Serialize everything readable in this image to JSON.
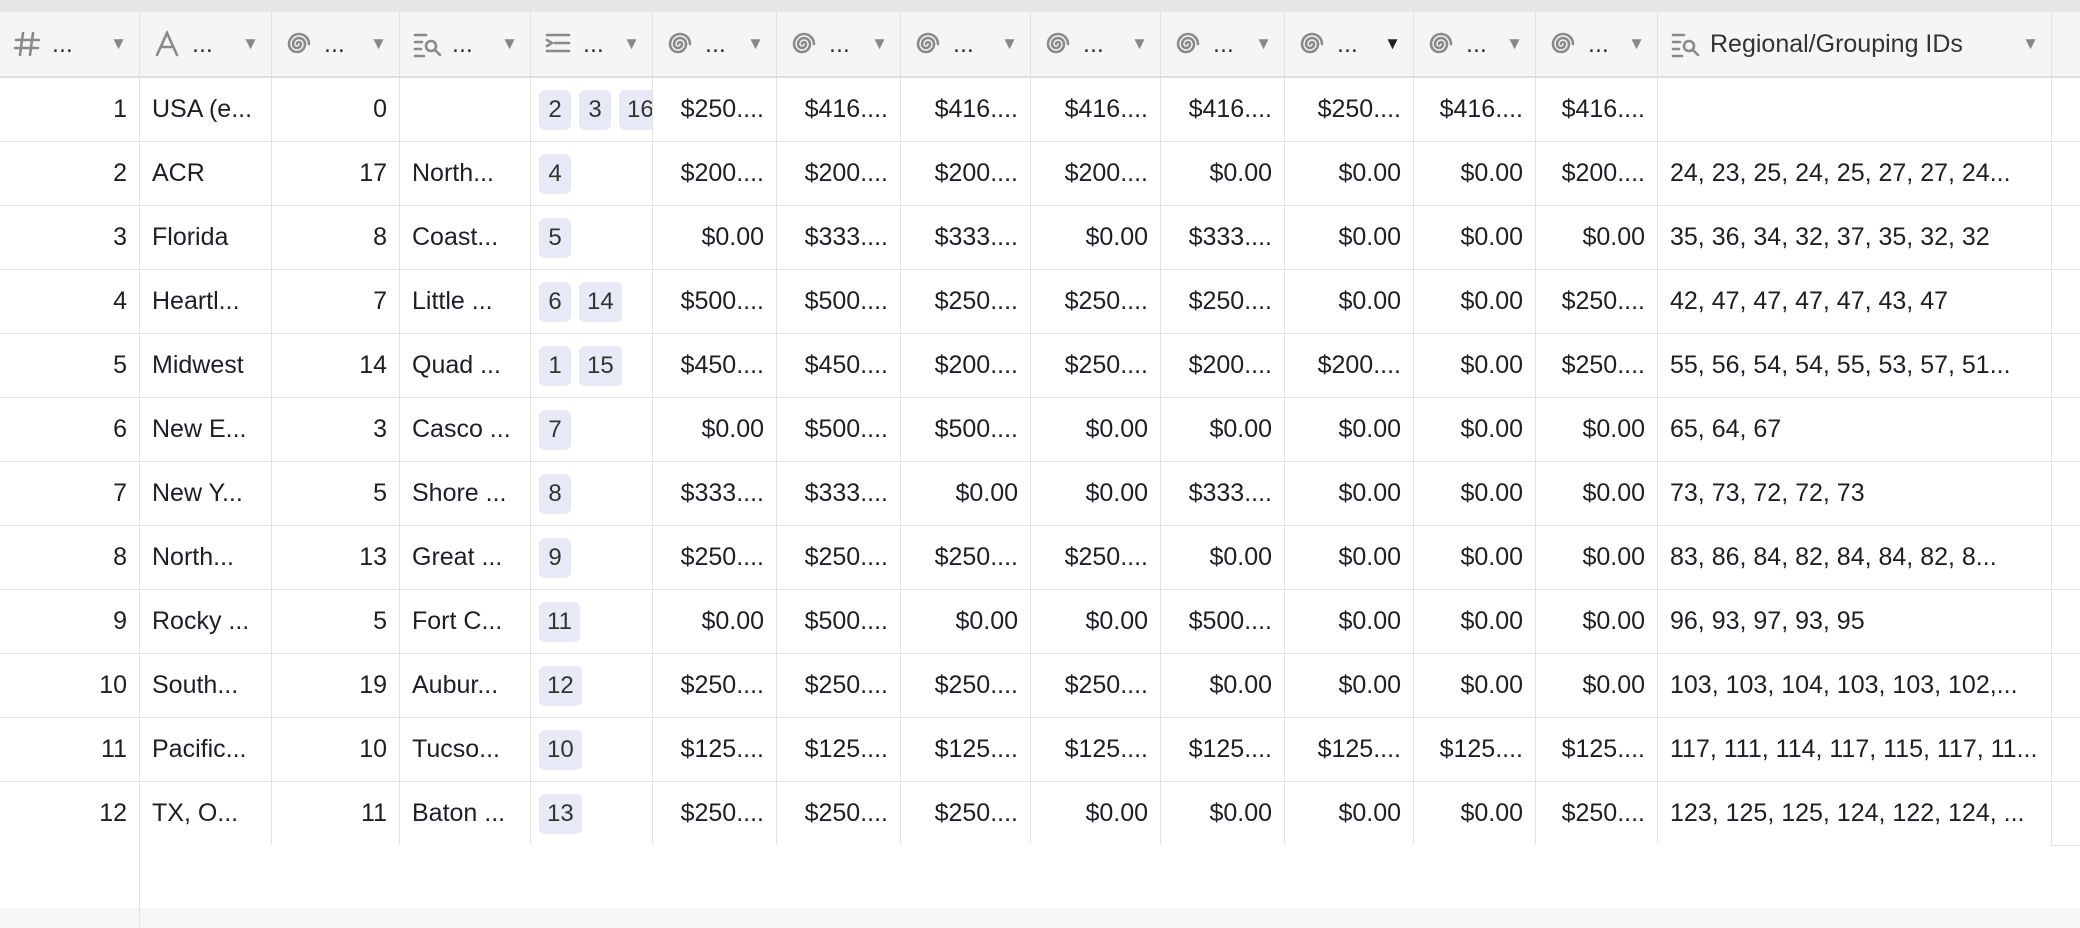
{
  "columns": [
    {
      "label": "...",
      "icon": "hash-icon"
    },
    {
      "label": "...",
      "icon": "text-icon"
    },
    {
      "label": "...",
      "icon": "spiral-icon"
    },
    {
      "label": "...",
      "icon": "lookup-icon"
    },
    {
      "label": "...",
      "icon": "linked-records-icon"
    },
    {
      "label": "...",
      "icon": "spiral-icon"
    },
    {
      "label": "...",
      "icon": "spiral-icon"
    },
    {
      "label": "...",
      "icon": "spiral-icon"
    },
    {
      "label": "...",
      "icon": "spiral-icon"
    },
    {
      "label": "...",
      "icon": "spiral-icon"
    },
    {
      "label": "...",
      "icon": "spiral-icon",
      "sorted": true
    },
    {
      "label": "...",
      "icon": "spiral-icon"
    },
    {
      "label": "...",
      "icon": "spiral-icon"
    },
    {
      "label": "Regional/Grouping IDs",
      "icon": "lookup-icon"
    }
  ],
  "rows": [
    {
      "id": "1",
      "name": "USA (e...",
      "count": "0",
      "lookup": "",
      "links": [
        "2",
        "3",
        "16"
      ],
      "m": [
        "$250....",
        "$416....",
        "$416....",
        "$416....",
        "$416....",
        "$250....",
        "$416....",
        "$416...."
      ],
      "ids": ""
    },
    {
      "id": "2",
      "name": "ACR",
      "count": "17",
      "lookup": "North...",
      "links": [
        "4"
      ],
      "m": [
        "$200....",
        "$200....",
        "$200....",
        "$200....",
        "$0.00",
        "$0.00",
        "$0.00",
        "$200...."
      ],
      "ids": "24, 23, 25, 24, 25, 27, 27, 24..."
    },
    {
      "id": "3",
      "name": "Florida",
      "count": "8",
      "lookup": "Coast...",
      "links": [
        "5"
      ],
      "m": [
        "$0.00",
        "$333....",
        "$333....",
        "$0.00",
        "$333....",
        "$0.00",
        "$0.00",
        "$0.00"
      ],
      "ids": "35, 36, 34, 32, 37, 35, 32, 32"
    },
    {
      "id": "4",
      "name": "Heartl...",
      "count": "7",
      "lookup": "Little ...",
      "links": [
        "6",
        "14"
      ],
      "m": [
        "$500....",
        "$500....",
        "$250....",
        "$250....",
        "$250....",
        "$0.00",
        "$0.00",
        "$250...."
      ],
      "ids": "42, 47, 47, 47, 47, 43, 47"
    },
    {
      "id": "5",
      "name": "Midwest",
      "count": "14",
      "lookup": "Quad ...",
      "links": [
        "1",
        "15"
      ],
      "m": [
        "$450....",
        "$450....",
        "$200....",
        "$250....",
        "$200....",
        "$200....",
        "$0.00",
        "$250...."
      ],
      "ids": "55, 56, 54, 54, 55, 53, 57, 51..."
    },
    {
      "id": "6",
      "name": "New E...",
      "count": "3",
      "lookup": "Casco ...",
      "links": [
        "7"
      ],
      "m": [
        "$0.00",
        "$500....",
        "$500....",
        "$0.00",
        "$0.00",
        "$0.00",
        "$0.00",
        "$0.00"
      ],
      "ids": "65, 64, 67"
    },
    {
      "id": "7",
      "name": "New Y...",
      "count": "5",
      "lookup": "Shore ...",
      "links": [
        "8"
      ],
      "m": [
        "$333....",
        "$333....",
        "$0.00",
        "$0.00",
        "$333....",
        "$0.00",
        "$0.00",
        "$0.00"
      ],
      "ids": "73, 73, 72, 72, 73"
    },
    {
      "id": "8",
      "name": "North...",
      "count": "13",
      "lookup": "Great ...",
      "links": [
        "9"
      ],
      "m": [
        "$250....",
        "$250....",
        "$250....",
        "$250....",
        "$0.00",
        "$0.00",
        "$0.00",
        "$0.00"
      ],
      "ids": "83, 86, 84, 82, 84, 84, 82, 8..."
    },
    {
      "id": "9",
      "name": "Rocky ...",
      "count": "5",
      "lookup": "Fort C...",
      "links": [
        "11"
      ],
      "m": [
        "$0.00",
        "$500....",
        "$0.00",
        "$0.00",
        "$500....",
        "$0.00",
        "$0.00",
        "$0.00"
      ],
      "ids": "96, 93, 97, 93, 95"
    },
    {
      "id": "10",
      "name": "South...",
      "count": "19",
      "lookup": "Aubur...",
      "links": [
        "12"
      ],
      "m": [
        "$250....",
        "$250....",
        "$250....",
        "$250....",
        "$0.00",
        "$0.00",
        "$0.00",
        "$0.00"
      ],
      "ids": "103, 103, 104, 103, 103, 102,..."
    },
    {
      "id": "11",
      "name": "Pacific...",
      "count": "10",
      "lookup": "Tucso...",
      "links": [
        "10"
      ],
      "m": [
        "$125....",
        "$125....",
        "$125....",
        "$125....",
        "$125....",
        "$125....",
        "$125....",
        "$125...."
      ],
      "ids": "117, 111, 114, 117, 115, 117, 11..."
    },
    {
      "id": "12",
      "name": "TX, O...",
      "count": "11",
      "lookup": "Baton ...",
      "links": [
        "13"
      ],
      "m": [
        "$250....",
        "$250....",
        "$250....",
        "$0.00",
        "$0.00",
        "$0.00",
        "$0.00",
        "$250...."
      ],
      "ids": "123, 125, 125, 124, 122, 124, ..."
    }
  ]
}
